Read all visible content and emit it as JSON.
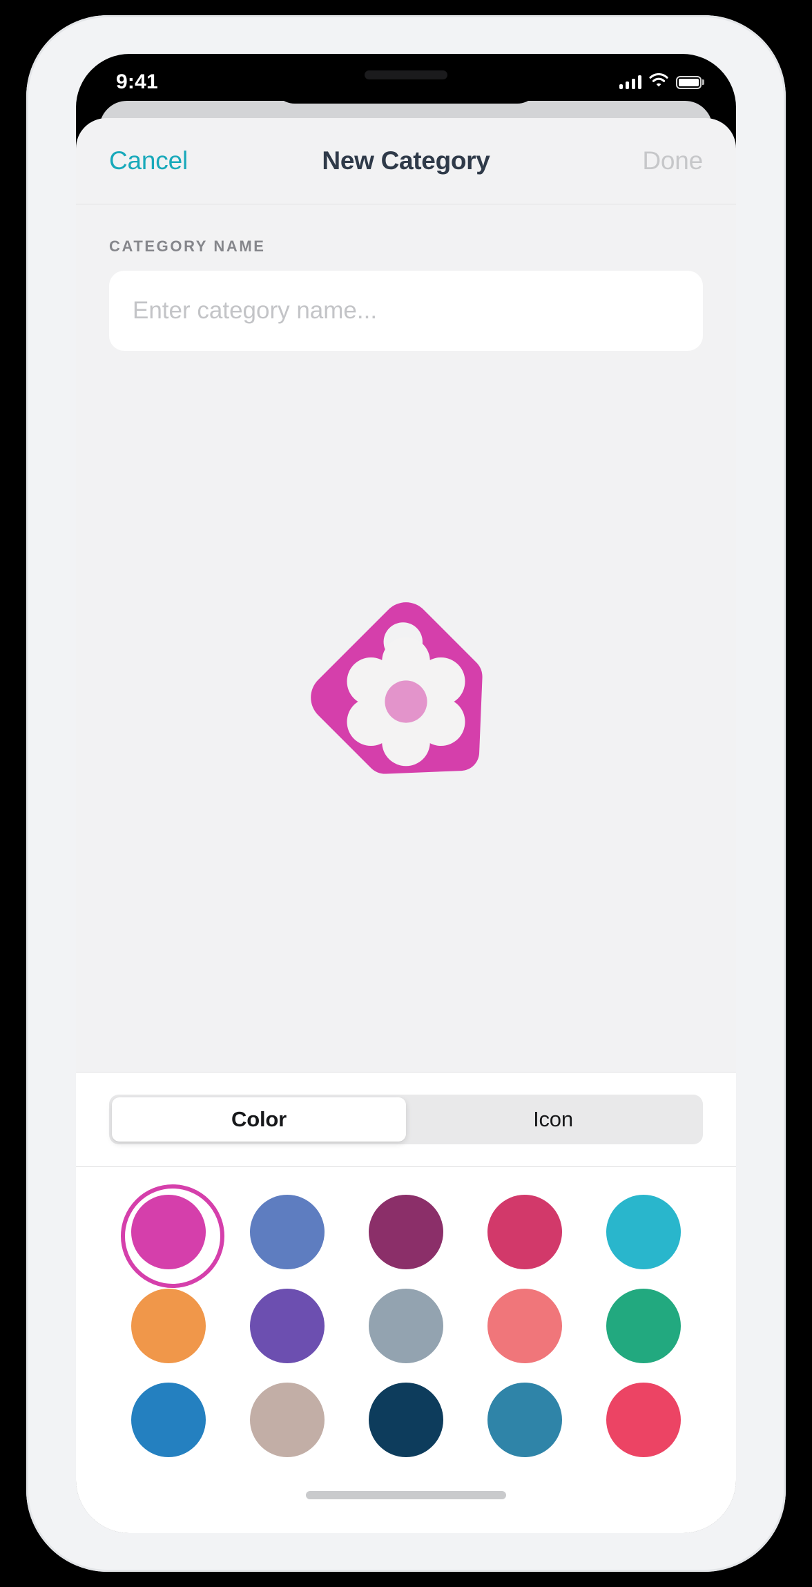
{
  "status_bar": {
    "time": "9:41",
    "icons": [
      "cellular-signal-icon",
      "wifi-icon",
      "battery-icon"
    ],
    "signal_bars": 4,
    "battery_level": 100
  },
  "nav_bar": {
    "cancel_label": "Cancel",
    "title": "New Category",
    "done_label": "Done",
    "cancel_color": "#18a9ba",
    "title_color": "#2f3a49",
    "done_color": "#c6c7c9",
    "done_enabled": false
  },
  "form": {
    "field_label": "CATEGORY NAME",
    "input_value": "",
    "input_placeholder": "Enter category name..."
  },
  "preview": {
    "icon_name": "flower-tag-icon",
    "tag_color": "#d53fab",
    "flower_petal_color": "#f4f3f3",
    "flower_center_color": "#e394cb",
    "hole_color": "#f2f2f3"
  },
  "segmented_control": {
    "segments": [
      {
        "label": "Color",
        "selected": true
      },
      {
        "label": "Icon",
        "selected": false
      }
    ]
  },
  "color_picker": {
    "selected_index": 0,
    "swatches": [
      {
        "name": "magenta",
        "hex": "#d53fab"
      },
      {
        "name": "cornflower",
        "hex": "#5e7dc0"
      },
      {
        "name": "plum",
        "hex": "#8b2f69"
      },
      {
        "name": "raspberry",
        "hex": "#d2396a"
      },
      {
        "name": "turquoise",
        "hex": "#29b6cc"
      },
      {
        "name": "orange",
        "hex": "#f0974a"
      },
      {
        "name": "violet",
        "hex": "#6c4fb0"
      },
      {
        "name": "slate-gray",
        "hex": "#93a3b0"
      },
      {
        "name": "salmon",
        "hex": "#f0767a"
      },
      {
        "name": "emerald",
        "hex": "#22a97f"
      },
      {
        "name": "azure",
        "hex": "#2480c0"
      },
      {
        "name": "taupe",
        "hex": "#c2aea6"
      },
      {
        "name": "navy",
        "hex": "#0d3c5c"
      },
      {
        "name": "steel-blue",
        "hex": "#2f84a8"
      },
      {
        "name": "rose",
        "hex": "#ec4464"
      }
    ]
  },
  "home_indicator": {
    "present": true
  }
}
